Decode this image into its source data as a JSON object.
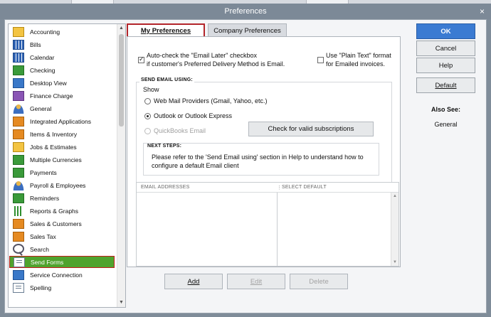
{
  "window": {
    "title": "Preferences",
    "close_glyph": "×"
  },
  "sidebar": {
    "items": [
      {
        "label": "Accounting",
        "icon": "accounting-icon"
      },
      {
        "label": "Bills",
        "icon": "bills-icon"
      },
      {
        "label": "Calendar",
        "icon": "calendar-icon"
      },
      {
        "label": "Checking",
        "icon": "checking-icon"
      },
      {
        "label": "Desktop View",
        "icon": "desktop-view-icon"
      },
      {
        "label": "Finance Charge",
        "icon": "finance-charge-icon"
      },
      {
        "label": "General",
        "icon": "general-icon"
      },
      {
        "label": "Integrated Applications",
        "icon": "integrated-apps-icon"
      },
      {
        "label": "Items & Inventory",
        "icon": "items-inventory-icon"
      },
      {
        "label": "Jobs & Estimates",
        "icon": "jobs-estimates-icon"
      },
      {
        "label": "Multiple Currencies",
        "icon": "multiple-currencies-icon"
      },
      {
        "label": "Payments",
        "icon": "payments-icon"
      },
      {
        "label": "Payroll & Employees",
        "icon": "payroll-icon"
      },
      {
        "label": "Reminders",
        "icon": "reminders-icon"
      },
      {
        "label": "Reports & Graphs",
        "icon": "reports-graphs-icon"
      },
      {
        "label": "Sales & Customers",
        "icon": "sales-customers-icon"
      },
      {
        "label": "Sales Tax",
        "icon": "sales-tax-icon"
      },
      {
        "label": "Search",
        "icon": "search-icon"
      },
      {
        "label": "Send Forms",
        "icon": "send-forms-icon"
      },
      {
        "label": "Service Connection",
        "icon": "service-connection-icon"
      },
      {
        "label": "Spelling",
        "icon": "spelling-icon"
      }
    ],
    "selected": "Send Forms"
  },
  "tabs": {
    "my_preferences": "My Preferences",
    "company_preferences": "Company Preferences"
  },
  "my_prefs": {
    "auto_check_line1": "Auto-check the \"Email Later\" checkbox",
    "auto_check_line2": "if customer's Preferred Delivery Method is Email.",
    "auto_check_checked": true,
    "plain_text_line1": "Use \"Plain Text\" format",
    "plain_text_line2": "for Emailed invoices.",
    "plain_text_checked": false,
    "send_email_using": "SEND EMAIL USING:",
    "show_label": "Show",
    "options": {
      "webmail": "Web Mail Providers (Gmail, Yahoo, etc.)",
      "outlook": "Outlook or Outlook Express",
      "quickbooks": "QuickBooks Email"
    },
    "selected_option": "Outlook or Outlook Express",
    "check_button": "Check for valid subscriptions",
    "next_steps_label": "NEXT STEPS:",
    "next_steps_line1": "Please refer to the 'Send Email using' section in Help to understand how to",
    "next_steps_line2": "configure a default Email client",
    "col_email": "EMAIL ADDRESSES",
    "col_select_default": "SELECT DEFAULT",
    "add": "Add",
    "edit": "Edit",
    "delete": "Delete"
  },
  "actions": {
    "ok": "OK",
    "cancel": "Cancel",
    "help": "Help",
    "default": "Default",
    "also_see_label": "Also See:",
    "also_see_link": "General"
  },
  "colors": {
    "selected_item_bg": "#4fa32e",
    "selection_border": "#c21d1d",
    "ok_button": "#3b7bd2"
  }
}
